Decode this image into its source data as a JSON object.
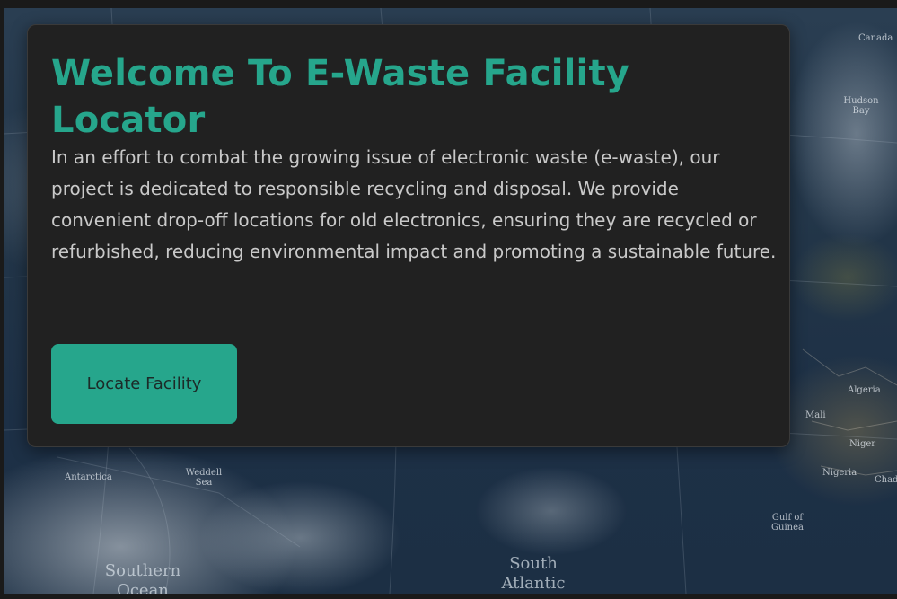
{
  "hero": {
    "title": "Welcome To E-Waste Facility Locator",
    "description": "In an effort to combat the growing issue of electronic waste (e-waste), our project is dedicated to responsible recycling and disposal. We provide convenient drop-off locations for old electronics, ensuring they are recycled or refurbished, reducing environmental impact and promoting a sustainable future.",
    "button_label": "Locate Facility"
  },
  "map": {
    "labels": {
      "hudson_bay": "Hudson Bay",
      "algeria": "Algeria",
      "mali": "Mali",
      "niger": "Niger",
      "nigeria": "Nigeria",
      "chad": "Chad",
      "gulf_of_guinea": "Gulf of Guinea",
      "antarctica": "Antarctica",
      "weddell_sea": "Weddell Sea",
      "southern_ocean": "Southern Ocean",
      "south_atlantic": "South Atlantic",
      "canada": "Canada"
    }
  },
  "colors": {
    "accent": "#26a68c",
    "card_background": "#212121",
    "body_text": "#c9c9c9",
    "page_background": "#1a1a1a",
    "ocean": "#223548"
  }
}
